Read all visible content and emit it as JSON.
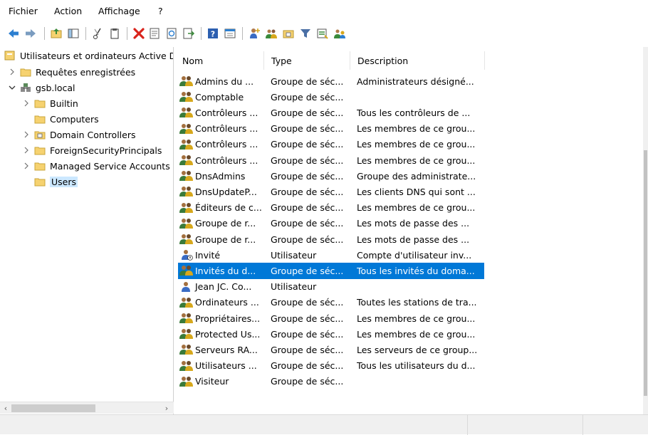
{
  "menu": [
    "Fichier",
    "Action",
    "Affichage",
    "?"
  ],
  "tree": {
    "root": "Utilisateurs et ordinateurs Active Directory",
    "items": [
      {
        "label": "Requêtes enregistrées"
      },
      {
        "label": "gsb.local"
      },
      {
        "label": "Builtin"
      },
      {
        "label": "Computers"
      },
      {
        "label": "Domain Controllers"
      },
      {
        "label": "ForeignSecurityPrincipals"
      },
      {
        "label": "Managed Service Accounts"
      },
      {
        "label": "Users"
      }
    ]
  },
  "columns": {
    "name": "Nom",
    "type": "Type",
    "description": "Description"
  },
  "rows": [
    {
      "name": "Admins du ...",
      "type": "Groupe de séc...",
      "description": "Administrateurs désigné...",
      "icon": "group-icon"
    },
    {
      "name": "Comptable",
      "type": "Groupe de séc...",
      "description": "",
      "icon": "group-icon"
    },
    {
      "name": "Contrôleurs ...",
      "type": "Groupe de séc...",
      "description": "Tous les contrôleurs de ...",
      "icon": "group-icon"
    },
    {
      "name": "Contrôleurs ...",
      "type": "Groupe de séc...",
      "description": "Les membres de ce grou...",
      "icon": "group-icon"
    },
    {
      "name": "Contrôleurs ...",
      "type": "Groupe de séc...",
      "description": "Les membres de ce grou...",
      "icon": "group-icon"
    },
    {
      "name": "Contrôleurs ...",
      "type": "Groupe de séc...",
      "description": "Les membres de ce grou...",
      "icon": "group-icon"
    },
    {
      "name": "DnsAdmins",
      "type": "Groupe de séc...",
      "description": "Groupe des administrate...",
      "icon": "group-icon"
    },
    {
      "name": "DnsUpdateP...",
      "type": "Groupe de séc...",
      "description": "Les clients DNS qui sont ...",
      "icon": "group-icon"
    },
    {
      "name": "Éditeurs de c...",
      "type": "Groupe de séc...",
      "description": "Les membres de ce grou...",
      "icon": "group-icon"
    },
    {
      "name": "Groupe de r...",
      "type": "Groupe de séc...",
      "description": "Les mots de passe des ...",
      "icon": "group-icon"
    },
    {
      "name": "Groupe de r...",
      "type": "Groupe de séc...",
      "description": "Les mots de passe des ...",
      "icon": "group-icon"
    },
    {
      "name": "Invité",
      "type": "Utilisateur",
      "description": "Compte d'utilisateur inv...",
      "icon": "disabled-user-icon"
    },
    {
      "name": "Invités du d...",
      "type": "Groupe de séc...",
      "description": "Tous les invités du doma...",
      "icon": "group-icon",
      "selected": true
    },
    {
      "name": "Jean JC. Co...",
      "type": "Utilisateur",
      "description": "",
      "icon": "user-icon"
    },
    {
      "name": "Ordinateurs ...",
      "type": "Groupe de séc...",
      "description": "Toutes les stations de tra...",
      "icon": "group-icon"
    },
    {
      "name": "Propriétaires...",
      "type": "Groupe de séc...",
      "description": "Les membres de ce grou...",
      "icon": "group-icon"
    },
    {
      "name": "Protected Us...",
      "type": "Groupe de séc...",
      "description": "Les membres de ce grou...",
      "icon": "group-icon"
    },
    {
      "name": "Serveurs RA...",
      "type": "Groupe de séc...",
      "description": "Les serveurs de ce group...",
      "icon": "group-icon"
    },
    {
      "name": "Utilisateurs ...",
      "type": "Groupe de séc...",
      "description": "Tous les utilisateurs du d...",
      "icon": "group-icon"
    },
    {
      "name": "Visiteur",
      "type": "Groupe de séc...",
      "description": "",
      "icon": "group-icon"
    }
  ],
  "colors": {
    "selection": "#0078d7",
    "tree_selection": "#cce8ff",
    "folder": "#f6d270",
    "toolbar_blue": "#2c7fd0",
    "delete_red": "#d9241c"
  }
}
